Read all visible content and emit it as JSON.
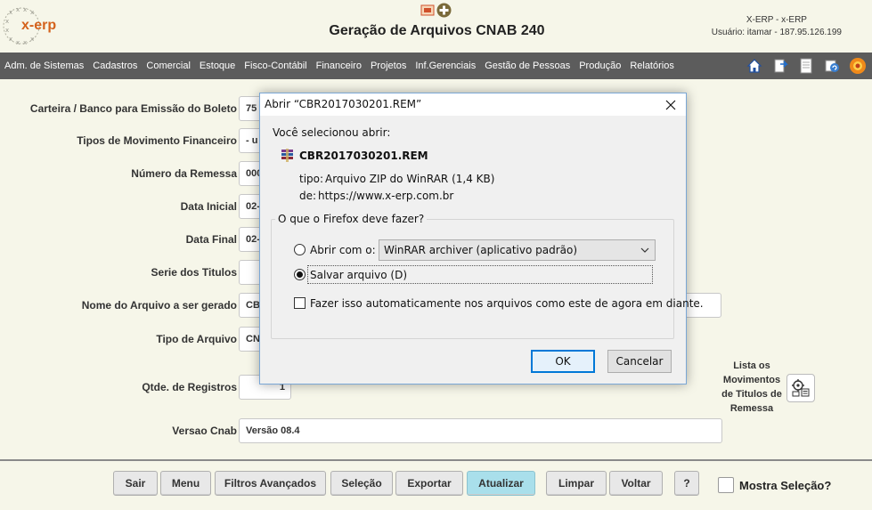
{
  "header": {
    "logo_text": "x-erp",
    "title": "Geração de Arquivos CNAB 240",
    "user_line1": "X-ERP - x-ERP",
    "user_line2": "Usuário: itamar - 187.95.126.199"
  },
  "menu": {
    "items": [
      "Adm. de Sistemas",
      "Cadastros",
      "Comercial",
      "Estoque",
      "Fisco-Contábil",
      "Financeiro",
      "Projetos",
      "Inf.Gerenciais",
      "Gestão de Pessoas",
      "Produção",
      "Relatórios"
    ],
    "icons": [
      "home-icon",
      "export-icon",
      "document-icon",
      "refresh-icon",
      "support-icon"
    ]
  },
  "form": {
    "fields": [
      {
        "label": "Carteira / Banco para Emissão do Boleto",
        "value": "75"
      },
      {
        "label": "Tipos de Movimento Financeiro",
        "value": "- u"
      },
      {
        "label": "Número da Remessa",
        "value": "000"
      },
      {
        "label": "Data Inicial",
        "value": "02-"
      },
      {
        "label": "Data Final",
        "value": "02-"
      },
      {
        "label": "Serie dos Titulos",
        "value": ""
      },
      {
        "label": "Nome do Arquivo a ser gerado",
        "value": "CB"
      },
      {
        "label": "Tipo de Arquivo",
        "value": "CN"
      },
      {
        "label": "Qtde. de Registros",
        "value": "1"
      },
      {
        "label": "Versao Cnab",
        "value": "Versão 08.4"
      }
    ],
    "side_label": "Lista os Movimentos de Titulos de Remessa"
  },
  "toolbar": {
    "buttons": [
      "Sair",
      "Menu",
      "Filtros Avançados",
      "Seleção",
      "Exportar",
      "Atualizar",
      "Limpar",
      "Voltar",
      "?"
    ],
    "active": "Atualizar",
    "check_label": "Mostra Seleção?"
  },
  "dialog": {
    "title": "Abrir “CBR2017030201.REM”",
    "intro": "Você selecionou abrir:",
    "filename": "CBR2017030201.REM",
    "type_label": "tipo:",
    "type_value": "Arquivo ZIP do WinRAR (1,4 KB)",
    "from_label": "de:",
    "from_value": "https://www.x-erp.com.br",
    "group_legend": "O que o Firefox deve fazer?",
    "open_with_label": "Abrir com o:",
    "open_with_value": "WinRAR archiver (aplicativo padrão)",
    "save_label": "Salvar arquivo (D)",
    "auto_label": "Fazer isso automaticamente nos arquivos como este de agora em diante.",
    "ok_label": "OK",
    "cancel_label": "Cancelar",
    "selected_option": "save"
  }
}
